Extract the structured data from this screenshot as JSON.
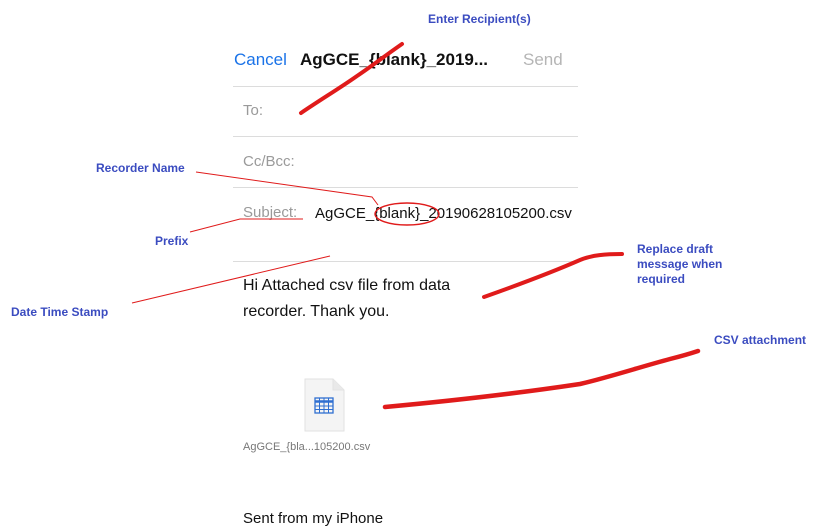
{
  "nav": {
    "cancel_label": "Cancel",
    "title": "AgGCE_{blank}_2019...",
    "send_label": "Send"
  },
  "fields": {
    "to_label": "To:",
    "ccbcc_label": "Cc/Bcc:",
    "subject_label": "Subject:",
    "subject_value": "AgGCE_{blank}_20190628105200.csv"
  },
  "body": {
    "message": "Hi Attached csv file from data recorder. Thank you."
  },
  "attachment": {
    "file_name": "AgGCE_{bla...105200.csv",
    "icon": "spreadsheet-file-icon"
  },
  "signature": "Sent from my iPhone",
  "annotations": {
    "enter_recipients": "Enter Recipient(s)",
    "recorder_name": "Recorder Name",
    "prefix": "Prefix",
    "date_time_stamp": "Date Time Stamp",
    "replace_draft": "Replace draft message when required",
    "csv_attachment": "CSV attachment"
  },
  "colors": {
    "ios_blue": "#1a73e8",
    "annotation_text": "#3b4cc0",
    "annotation_stroke": "#e01b1b"
  }
}
